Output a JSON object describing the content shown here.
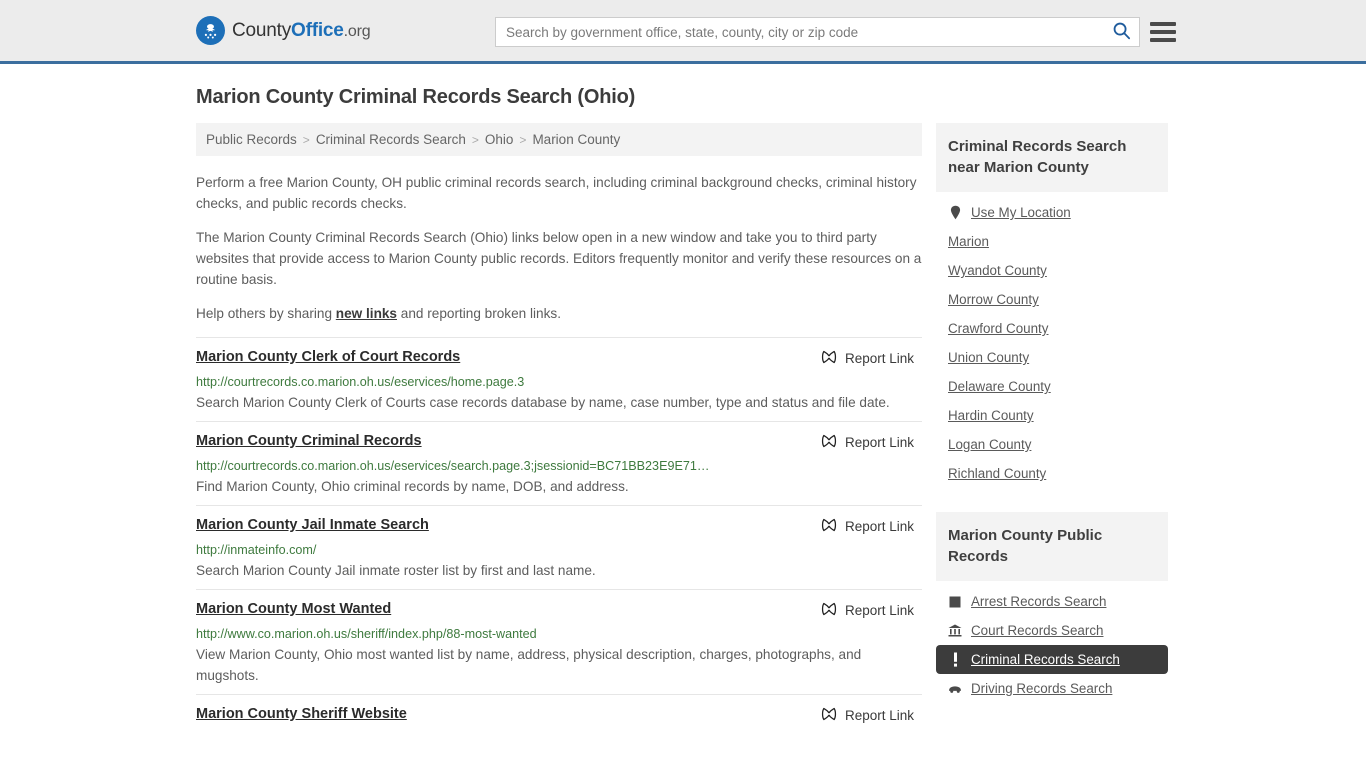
{
  "header": {
    "brand": {
      "part1": "County",
      "part2": "Office",
      "part3": ".org",
      "emblem_icon": "eagle-seal-icon"
    },
    "search": {
      "placeholder": "Search by government office, state, county, city or zip code",
      "value": "",
      "icon": "search-icon"
    },
    "menu_icon": "hamburger-menu-icon",
    "accent_color": "#3b6e9e",
    "background_color": "#ececec"
  },
  "page": {
    "title": "Marion County Criminal Records Search (Ohio)"
  },
  "breadcrumb": {
    "separator": ">",
    "items": [
      {
        "label": "Public Records"
      },
      {
        "label": "Criminal Records Search"
      },
      {
        "label": "Ohio"
      },
      {
        "label": "Marion County"
      }
    ]
  },
  "intro": {
    "paragraph1": "Perform a free Marion County, OH public criminal records search, including criminal background checks, criminal history checks, and public records checks.",
    "paragraph2": "The Marion County Criminal Records Search (Ohio) links below open in a new window and take you to third party websites that provide access to Marion County public records. Editors frequently monitor and verify these resources on a routine basis.",
    "paragraph3_before": "Help others by sharing ",
    "paragraph3_link": "new links",
    "paragraph3_after": " and reporting broken links."
  },
  "results": {
    "report_label": "Report Link",
    "report_icon": "broken-link-icon",
    "items": [
      {
        "title": "Marion County Clerk of Court Records",
        "url": "http://courtrecords.co.marion.oh.us/eservices/home.page.3",
        "description": "Search Marion County Clerk of Courts case records database by name, case number, type and status and file date."
      },
      {
        "title": "Marion County Criminal Records",
        "url": "http://courtrecords.co.marion.oh.us/eservices/search.page.3;jsessionid=BC71BB23E9E71…",
        "description": "Find Marion County, Ohio criminal records by name, DOB, and address."
      },
      {
        "title": "Marion County Jail Inmate Search",
        "url": "http://inmateinfo.com/",
        "description": "Search Marion County Jail inmate roster list by first and last name."
      },
      {
        "title": "Marion County Most Wanted",
        "url": "http://www.co.marion.oh.us/sheriff/index.php/88-most-wanted",
        "description": "View Marion County, Ohio most wanted list by name, address, physical description, charges, photographs, and mugshots."
      },
      {
        "title": "Marion County Sheriff Website",
        "url": "",
        "description": ""
      }
    ]
  },
  "sidebar": {
    "nearby_panel": {
      "title": "Criminal Records Search near Marion County",
      "items": [
        {
          "label": "Use My Location",
          "icon": "map-pin-icon"
        },
        {
          "label": "Marion",
          "icon": ""
        },
        {
          "label": "Wyandot County",
          "icon": ""
        },
        {
          "label": "Morrow County",
          "icon": ""
        },
        {
          "label": "Crawford County",
          "icon": ""
        },
        {
          "label": "Union County",
          "icon": ""
        },
        {
          "label": "Delaware County",
          "icon": ""
        },
        {
          "label": "Hardin County",
          "icon": ""
        },
        {
          "label": "Logan County",
          "icon": ""
        },
        {
          "label": "Richland County",
          "icon": ""
        }
      ]
    },
    "records_panel": {
      "title": "Marion County Public Records",
      "active_label": "Criminal Records Search",
      "items": [
        {
          "label": "Arrest Records Search",
          "icon": "arrest-square-icon",
          "active": false
        },
        {
          "label": "Court Records Search",
          "icon": "courthouse-icon",
          "active": false
        },
        {
          "label": "Criminal Records Search",
          "icon": "exclamation-icon",
          "active": true
        },
        {
          "label": "Driving Records Search",
          "icon": "car-icon",
          "active": false
        }
      ]
    }
  }
}
